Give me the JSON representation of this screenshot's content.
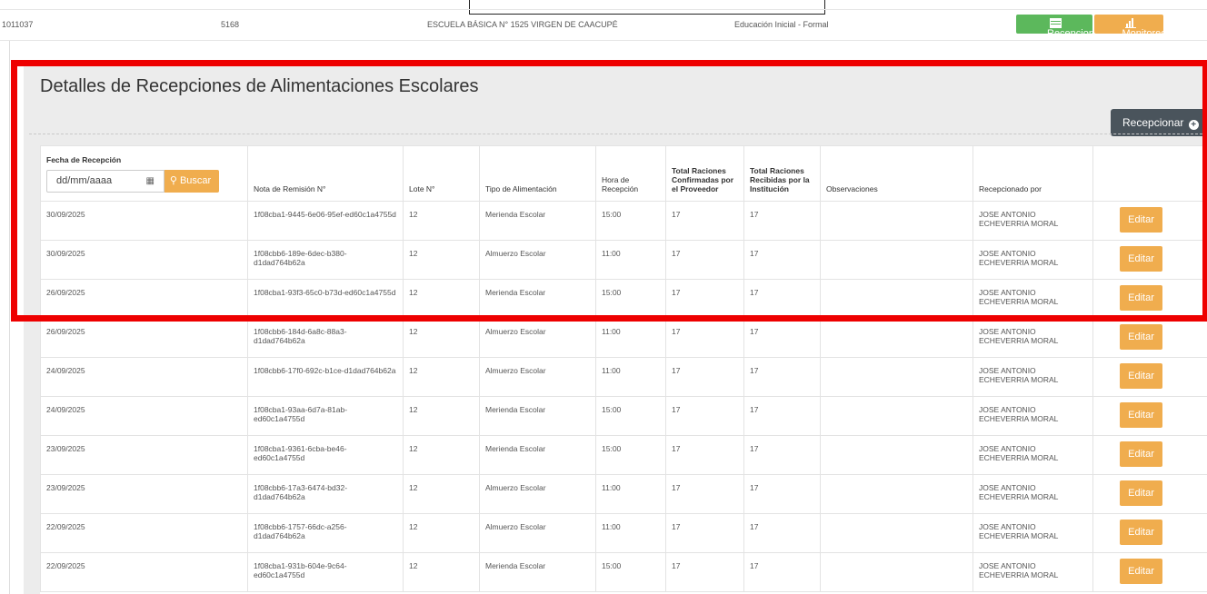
{
  "top_row": {
    "code": "1011037",
    "number": "5168",
    "school": "ESCUELA BÁSICA N° 1525 VIRGEN DE CAACUPÉ",
    "level": "Educación Inicial - Formal",
    "btn_recepciones": "Recepciones",
    "btn_monitoreo": "Monitoreo"
  },
  "panel": {
    "title": "Detalles de Recepciones de Alimentaciones Escolares",
    "recepcionar_label": "Recepcionar"
  },
  "filter": {
    "date_label": "Fecha de Recepción",
    "date_placeholder": "dd/mm/aaaa",
    "search_label": "Buscar"
  },
  "table": {
    "headers": [
      "Nota de Remisión N°",
      "Lote N°",
      "Tipo de Alimentación",
      "Hora de Recepción",
      "Total Raciones Confirmadas por el Proveedor",
      "Total Raciones Recibidas por la Institución",
      "Observaciones",
      "Recepcionado por"
    ],
    "edit_label": "Editar",
    "rows": [
      [
        "30/09/2025",
        "1f08cba1-9445-6e06-95ef-ed60c1a4755d",
        "12",
        "Merienda Escolar",
        "15:00",
        "17",
        "17",
        "",
        "JOSE ANTONIO ECHEVERRIA MORAL"
      ],
      [
        "30/09/2025",
        "1f08cbb6-189e-6dec-b380-d1dad764b62a",
        "12",
        "Almuerzo Escolar",
        "11:00",
        "17",
        "17",
        "",
        "JOSE ANTONIO ECHEVERRIA MORAL"
      ],
      [
        "26/09/2025",
        "1f08cba1-93f3-65c0-b73d-ed60c1a4755d",
        "12",
        "Merienda Escolar",
        "15:00",
        "17",
        "17",
        "",
        "JOSE ANTONIO ECHEVERRIA MORAL"
      ],
      [
        "26/09/2025",
        "1f08cbb6-184d-6a8c-88a3-d1dad764b62a",
        "12",
        "Almuerzo Escolar",
        "11:00",
        "17",
        "17",
        "",
        "JOSE ANTONIO ECHEVERRIA MORAL"
      ],
      [
        "24/09/2025",
        "1f08cbb6-17f0-692c-b1ce-d1dad764b62a",
        "12",
        "Almuerzo Escolar",
        "11:00",
        "17",
        "17",
        "",
        "JOSE ANTONIO ECHEVERRIA MORAL"
      ],
      [
        "24/09/2025",
        "1f08cba1-93aa-6d7a-81ab-ed60c1a4755d",
        "12",
        "Merienda Escolar",
        "15:00",
        "17",
        "17",
        "",
        "JOSE ANTONIO ECHEVERRIA MORAL"
      ],
      [
        "23/09/2025",
        "1f08cba1-9361-6cba-be46-ed60c1a4755d",
        "12",
        "Merienda Escolar",
        "15:00",
        "17",
        "17",
        "",
        "JOSE ANTONIO ECHEVERRIA MORAL"
      ],
      [
        "23/09/2025",
        "1f08cbb6-17a3-6474-bd32-d1dad764b62a",
        "12",
        "Almuerzo Escolar",
        "11:00",
        "17",
        "17",
        "",
        "JOSE ANTONIO ECHEVERRIA MORAL"
      ],
      [
        "22/09/2025",
        "1f08cbb6-1757-66dc-a256-d1dad764b62a",
        "12",
        "Almuerzo Escolar",
        "11:00",
        "17",
        "17",
        "",
        "JOSE ANTONIO ECHEVERRIA MORAL"
      ],
      [
        "22/09/2025",
        "1f08cba1-931b-604e-9c64-ed60c1a4755d",
        "12",
        "Merienda Escolar",
        "15:00",
        "17",
        "17",
        "",
        "JOSE ANTONIO ECHEVERRIA MORAL"
      ]
    ]
  },
  "colors": {
    "green": "#5cb85c",
    "orange": "#f0ad4e",
    "dark_button": "#4a545c",
    "highlight_red": "#ee0000"
  }
}
